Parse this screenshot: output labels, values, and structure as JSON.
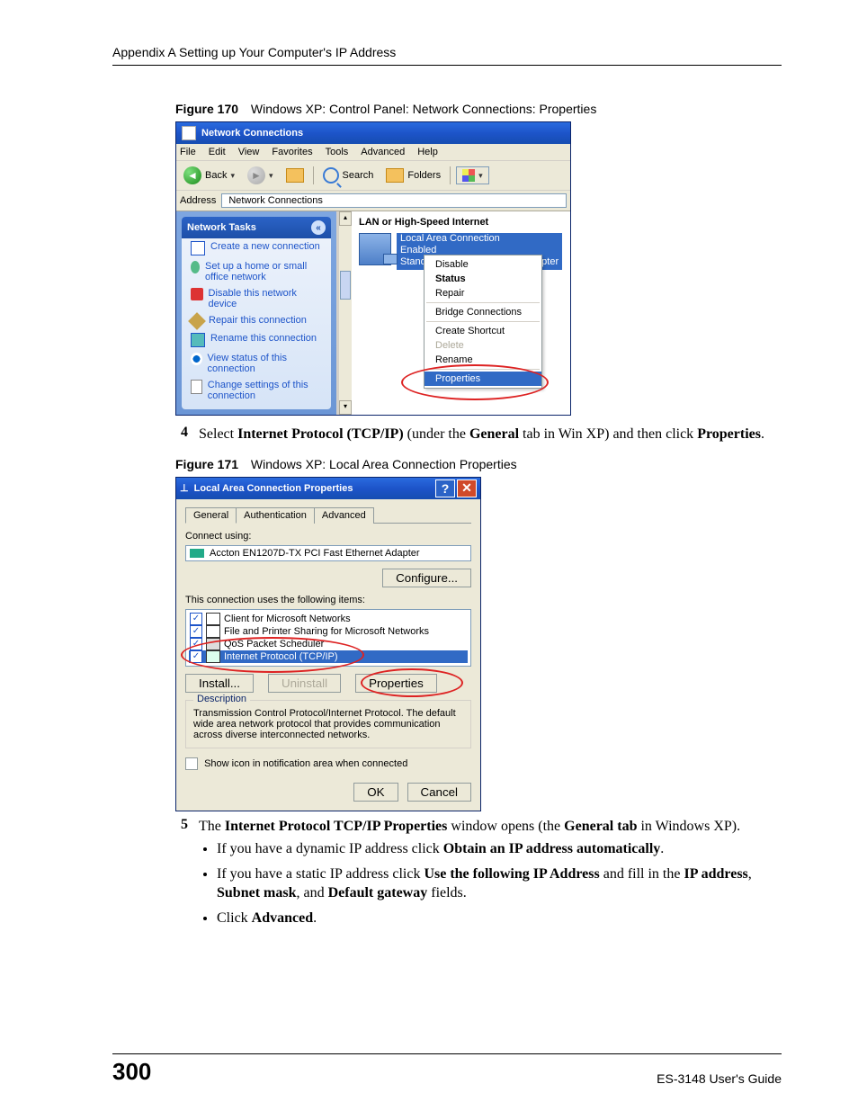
{
  "header": {
    "running": "Appendix A Setting up Your Computer's IP Address"
  },
  "fig170": {
    "num": "Figure 170",
    "caption": "Windows XP: Control Panel: Network Connections: Properties",
    "title": "Network Connections",
    "menu": {
      "file": "File",
      "edit": "Edit",
      "view": "View",
      "favorites": "Favorites",
      "tools": "Tools",
      "advanced": "Advanced",
      "help": "Help"
    },
    "toolbar": {
      "back": "Back",
      "search": "Search",
      "folders": "Folders"
    },
    "addr_label": "Address",
    "addr_value": "Network Connections",
    "tasks_head": "Network Tasks",
    "tasks": {
      "create": "Create a new connection",
      "setup": "Set up a home or small office network",
      "disable": "Disable this network device",
      "repair": "Repair this connection",
      "rename": "Rename this connection",
      "status": "View status of this connection",
      "change": "Change settings of this connection"
    },
    "category": "LAN or High-Speed Internet",
    "conn": {
      "name": "Local Area Connection",
      "state": "Enabled",
      "adapter": "Standard PCI Fast Ethernet Adapter"
    },
    "ctx": {
      "disable": "Disable",
      "status": "Status",
      "repair": "Repair",
      "bridge": "Bridge Connections",
      "shortcut": "Create Shortcut",
      "delete": "Delete",
      "rename": "Rename",
      "properties": "Properties"
    }
  },
  "step4": {
    "num": "4",
    "pre": "Select ",
    "b1": "Internet Protocol (TCP/IP)",
    "mid": " (under the ",
    "b2": "General",
    "mid2": " tab in Win XP) and then click ",
    "b3": "Properties",
    "post": "."
  },
  "fig171": {
    "num": "Figure 171",
    "caption": "Windows XP: Local Area Connection Properties",
    "title": "Local Area Connection Properties",
    "tabs": {
      "general": "General",
      "auth": "Authentication",
      "adv": "Advanced"
    },
    "connect_using": "Connect using:",
    "adapter": "Accton EN1207D-TX PCI Fast Ethernet Adapter",
    "configure": "Configure...",
    "items_label": "This connection uses the following items:",
    "items": {
      "a": "Client for Microsoft Networks",
      "b": "File and Printer Sharing for Microsoft Networks",
      "c": "QoS Packet Scheduler",
      "d": "Internet Protocol (TCP/IP)"
    },
    "install": "Install...",
    "uninstall": "Uninstall",
    "properties": "Properties",
    "desc_head": "Description",
    "desc_body": "Transmission Control Protocol/Internet Protocol. The default wide area network protocol that provides communication across diverse interconnected networks.",
    "show_icon": "Show icon in notification area when connected",
    "ok": "OK",
    "cancel": "Cancel"
  },
  "step5": {
    "num": "5",
    "pre": "The ",
    "b1": "Internet Protocol TCP/IP Properties",
    "mid": " window opens (the ",
    "b2": "General tab",
    "mid2": " in Windows XP).",
    "bullets": {
      "one_pre": "If you have a dynamic IP address click ",
      "one_b": "Obtain an IP address automatically",
      "one_post": ".",
      "two_pre": "If you have a static IP address click ",
      "two_b1": "Use the following IP Address",
      "two_mid": " and fill in the ",
      "two_b2": "IP address",
      "two_sep1": ", ",
      "two_b3": "Subnet mask",
      "two_sep2": ", and ",
      "two_b4": "Default gateway",
      "two_post": " fields.",
      "three_pre": "Click ",
      "three_b": "Advanced",
      "three_post": "."
    }
  },
  "footer": {
    "page": "300",
    "guide": "ES-3148 User's Guide"
  }
}
